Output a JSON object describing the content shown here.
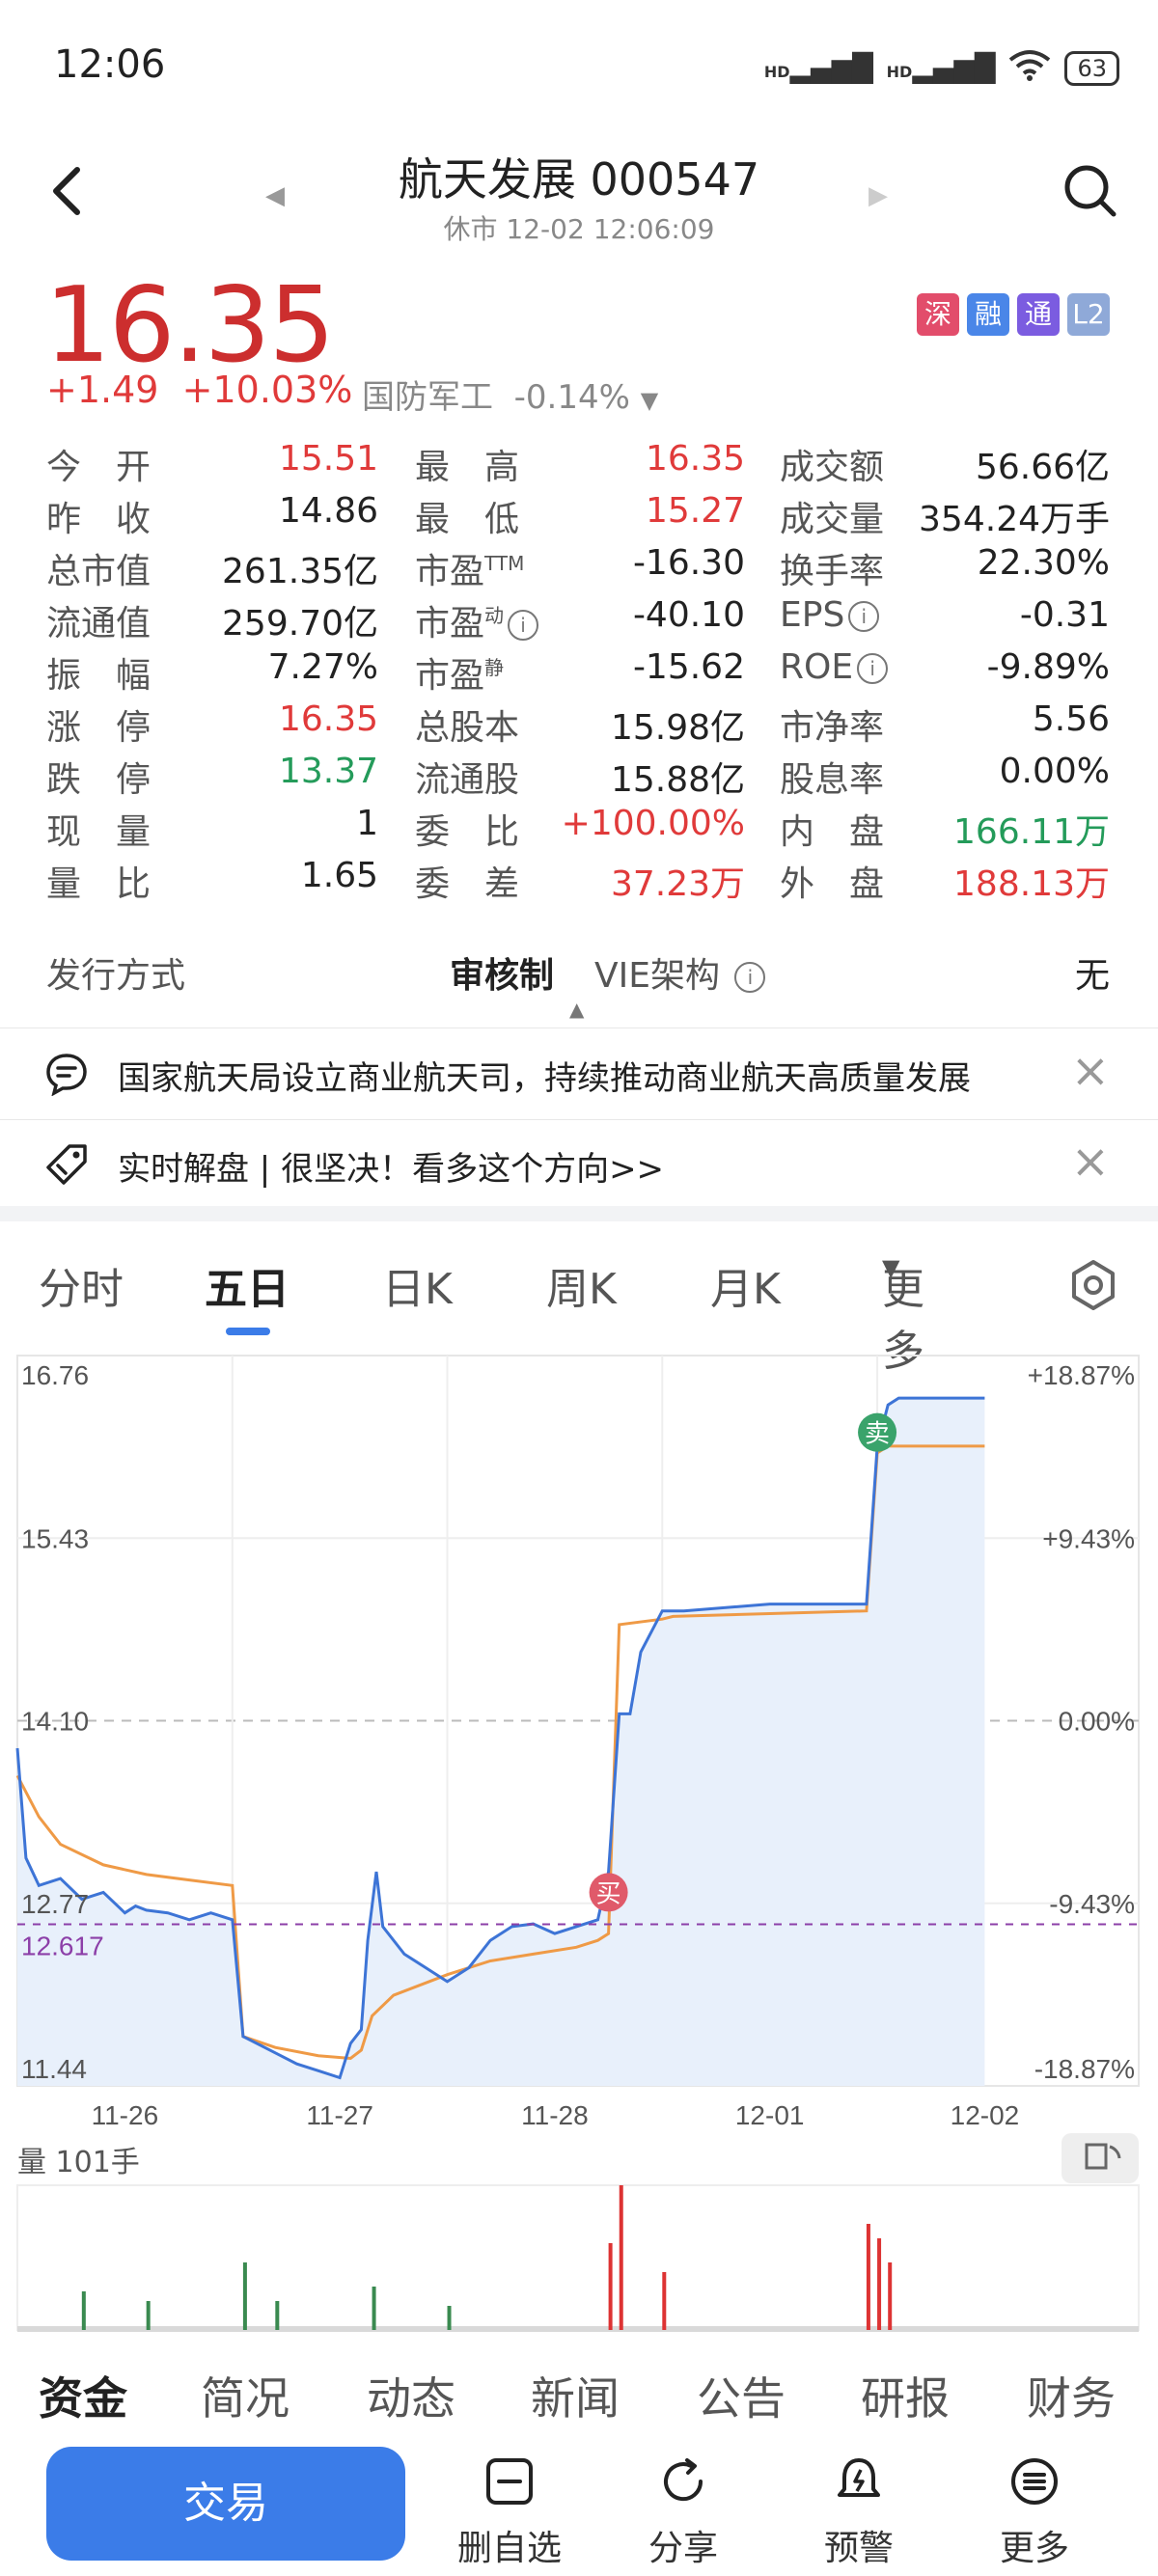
{
  "status": {
    "time": "12:06",
    "signal1": "HD",
    "signal2": "HD",
    "battery": "63"
  },
  "header": {
    "title": "航天发展 000547",
    "subtitle": "休市 12-02 12:06:09"
  },
  "quote": {
    "price": "16.35",
    "change": "+1.49",
    "change_pct": "+10.03%",
    "sector": "国防军工",
    "sector_change": "-0.14%",
    "badges": [
      {
        "label": "深",
        "color": "#e24d6b"
      },
      {
        "label": "融",
        "color": "#4a86e8"
      },
      {
        "label": "通",
        "color": "#7b5ce0"
      },
      {
        "label": "L2",
        "color": "#8fa9d8"
      }
    ]
  },
  "stats": [
    [
      {
        "label": "今　开",
        "value": "15.51",
        "color": "red"
      },
      {
        "label": "最　高",
        "value": "16.35",
        "color": "red"
      },
      {
        "label": "成交额",
        "value": "56.66亿",
        "color": "black"
      }
    ],
    [
      {
        "label": "昨　收",
        "value": "14.86",
        "color": "black"
      },
      {
        "label": "最　低",
        "value": "15.27",
        "color": "red"
      },
      {
        "label": "成交量",
        "value": "354.24万手",
        "color": "black"
      }
    ],
    [
      {
        "label": "总市值",
        "value": "261.35亿",
        "color": "black"
      },
      {
        "label": "市盈",
        "sup": "TTM",
        "value": "-16.30",
        "color": "black"
      },
      {
        "label": "换手率",
        "value": "22.30%",
        "color": "black"
      }
    ],
    [
      {
        "label": "流通值",
        "value": "259.70亿",
        "color": "black"
      },
      {
        "label": "市盈",
        "sup": "动",
        "info": true,
        "value": "-40.10",
        "color": "black"
      },
      {
        "label": "EPS",
        "info": true,
        "value": "-0.31",
        "color": "black"
      }
    ],
    [
      {
        "label": "振　幅",
        "value": "7.27%",
        "color": "black"
      },
      {
        "label": "市盈",
        "sup": "静",
        "value": "-15.62",
        "color": "black"
      },
      {
        "label": "ROE",
        "info": true,
        "value": "-9.89%",
        "color": "black"
      }
    ],
    [
      {
        "label": "涨　停",
        "value": "16.35",
        "color": "red"
      },
      {
        "label": "总股本",
        "value": "15.98亿",
        "color": "black"
      },
      {
        "label": "市净率",
        "value": "5.56",
        "color": "black"
      }
    ],
    [
      {
        "label": "跌　停",
        "value": "13.37",
        "color": "green"
      },
      {
        "label": "流通股",
        "value": "15.88亿",
        "color": "black"
      },
      {
        "label": "股息率",
        "value": "0.00%",
        "color": "black"
      }
    ],
    [
      {
        "label": "现　量",
        "value": "1",
        "color": "black"
      },
      {
        "label": "委　比",
        "value": "+100.00%",
        "color": "red"
      },
      {
        "label": "内　盘",
        "value": "166.11万",
        "color": "green"
      }
    ],
    [
      {
        "label": "量　比",
        "value": "1.65",
        "color": "black"
      },
      {
        "label": "委　差",
        "value": "37.23万",
        "color": "red"
      },
      {
        "label": "外　盘",
        "value": "188.13万",
        "color": "red"
      }
    ]
  ],
  "issue": {
    "label": "发行方式",
    "value": "审核制",
    "vie_label": "VIE架构",
    "vie_value": "无"
  },
  "news": [
    {
      "text": "国家航天局设立商业航天司，持续推动商业航天高质量发展"
    },
    {
      "text": "实时解盘 | 很坚决！看多这个方向>>"
    }
  ],
  "chart_tabs": [
    "分时",
    "五日",
    "日K",
    "周K",
    "月K",
    "更多"
  ],
  "chart_active_tab": "五日",
  "chart_data": {
    "type": "line",
    "y_left_ticks": [
      "16.76",
      "15.43",
      "14.10",
      "12.77",
      "11.44"
    ],
    "y_right_ticks": [
      "+18.87%",
      "+9.43%",
      "0.00%",
      "-9.43%",
      "-18.87%"
    ],
    "x_ticks": [
      "11-26",
      "11-27",
      "11-28",
      "12-01",
      "12-02"
    ],
    "ylim": [
      11.44,
      16.76
    ],
    "prev_close": 14.1,
    "cost_line": {
      "value": 12.617,
      "label": "12.617"
    },
    "markers": [
      {
        "label": "买",
        "color": "#e05a6a"
      },
      {
        "label": "卖",
        "color": "#3aa36b"
      }
    ],
    "series": [
      {
        "x": [
          0,
          0.04,
          0.1,
          0.2,
          0.3,
          0.4,
          0.5,
          0.55,
          0.6,
          0.7,
          0.8,
          0.9,
          1.0,
          1.05,
          1.2,
          1.3,
          1.4,
          1.5,
          1.55,
          1.6,
          1.63,
          1.67,
          1.7,
          1.8,
          1.9,
          2.0,
          2.1,
          2.2,
          2.3,
          2.4,
          2.5,
          2.6,
          2.7,
          2.75,
          2.8,
          2.85,
          2.9,
          3.0,
          3.1,
          3.5,
          3.95,
          4.0,
          4.05,
          4.1,
          4.3,
          4.5
        ],
        "y": [
          13.9,
          13.1,
          12.9,
          12.95,
          12.8,
          12.85,
          12.7,
          12.75,
          12.72,
          12.7,
          12.65,
          12.7,
          12.65,
          11.8,
          11.68,
          11.6,
          11.55,
          11.5,
          11.75,
          11.85,
          12.5,
          13.0,
          12.6,
          12.4,
          12.3,
          12.2,
          12.3,
          12.5,
          12.6,
          12.62,
          12.55,
          12.6,
          12.65,
          13.0,
          14.15,
          14.15,
          14.6,
          14.9,
          14.9,
          14.95,
          14.95,
          16.1,
          16.4,
          16.45,
          16.45,
          16.45
        ]
      },
      {
        "x": [
          0,
          0.1,
          0.2,
          0.4,
          0.6,
          0.8,
          1.0,
          1.05,
          1.2,
          1.4,
          1.55,
          1.6,
          1.65,
          1.75,
          2.0,
          2.2,
          2.4,
          2.6,
          2.7,
          2.75,
          2.8,
          3.0,
          3.05,
          3.5,
          3.95,
          4.0,
          4.05,
          4.5
        ],
        "y": [
          13.7,
          13.4,
          13.2,
          13.05,
          12.98,
          12.94,
          12.9,
          11.8,
          11.72,
          11.66,
          11.64,
          11.7,
          11.95,
          12.1,
          12.25,
          12.35,
          12.4,
          12.45,
          12.5,
          12.55,
          14.8,
          14.84,
          14.86,
          14.88,
          14.9,
          16.05,
          16.1,
          16.1
        ]
      }
    ]
  },
  "volume": {
    "label": "量 101手"
  },
  "bottom_tabs": [
    "资金",
    "简况",
    "动态",
    "新闻",
    "公告",
    "研报",
    "财务"
  ],
  "nav": {
    "trade": "交易",
    "items": [
      "删自选",
      "分享",
      "预警",
      "更多"
    ]
  }
}
